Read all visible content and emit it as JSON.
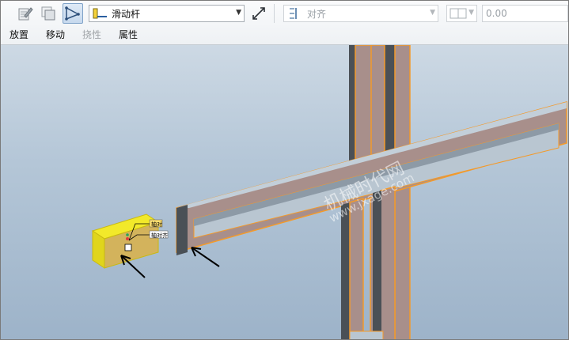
{
  "toolbar": {
    "feature_icon": "edit-definition-icon",
    "copy_icon": "copy-icon",
    "curve_icon": "curve-tool-icon",
    "connection_type": "滑动杆",
    "flip_icon": "flip-icon",
    "constraint_type": "对齐",
    "offset_value": "0.00"
  },
  "tabs": [
    {
      "label": "放置",
      "enabled": true
    },
    {
      "label": "移动",
      "enabled": true
    },
    {
      "label": "挠性",
      "enabled": false
    },
    {
      "label": "属性",
      "enabled": true
    }
  ],
  "viewport": {
    "axis_label_1": "轴对",
    "axis_label_2": "轴对齐",
    "watermark_1": "机械时代网",
    "watermark_2": "www.jxage.com"
  },
  "colors": {
    "highlight_orange": "#f39a2b",
    "part_yellow": "#f2e92a",
    "frame_face": "#b9c6d1"
  }
}
